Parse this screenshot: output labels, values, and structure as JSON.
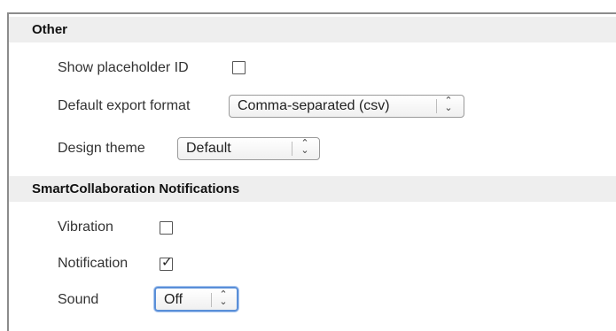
{
  "sections": {
    "other": {
      "title": "Other",
      "show_placeholder_id": {
        "label": "Show placeholder ID",
        "checked": false
      },
      "default_export_format": {
        "label": "Default export format",
        "value": "Comma-separated (csv)"
      },
      "design_theme": {
        "label": "Design theme",
        "value": "Default"
      }
    },
    "notifications": {
      "title": "SmartCollaboration Notifications",
      "vibration": {
        "label": "Vibration",
        "checked": false
      },
      "notification": {
        "label": "Notification",
        "checked": true
      },
      "sound": {
        "label": "Sound",
        "value": "Off"
      }
    }
  },
  "icons": {
    "select_arrow": "up-down-chevron-icon",
    "check": "checkmark-icon"
  },
  "colors": {
    "section_header_bg": "#eeeeee",
    "focus_ring": "#5a8fd8"
  }
}
